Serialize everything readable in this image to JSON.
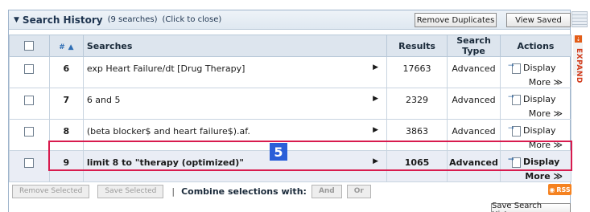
{
  "header": {
    "title": "Search History",
    "count": "(9 searches)",
    "hint": "(Click to close)",
    "remove_duplicates": "Remove Duplicates",
    "view_saved": "View Saved"
  },
  "table": {
    "columns": [
      "#",
      "Searches",
      "Results",
      "Search Type",
      "Actions"
    ],
    "sort_indicator": "▲",
    "rows": [
      {
        "num": "6",
        "search": "exp Heart Failure/dt [Drug Therapy]",
        "results": "17663",
        "type": "Advanced",
        "display": "Display",
        "more": "More ≫"
      },
      {
        "num": "7",
        "search": "6 and 5",
        "results": "2329",
        "type": "Advanced",
        "display": "Display",
        "more": "More ≫"
      },
      {
        "num": "8",
        "search": "(beta blocker$ and heart failure$).af.",
        "results": "3863",
        "type": "Advanced",
        "display": "Display",
        "more": "More ≫"
      },
      {
        "num": "9",
        "search": "limit 8 to \"therapy (optimized)\"",
        "results": "1065",
        "type": "Advanced",
        "display": "Display",
        "more": "More ≫"
      }
    ]
  },
  "marker": "5",
  "bottom": {
    "remove_selected": "Remove Selected",
    "save_selected": "Save Selected",
    "combine_label": "Combine selections with:",
    "and": "And",
    "or": "Or",
    "rss": "RSS",
    "save_history": "Save Search History"
  },
  "expand": "EXPAND",
  "colors": {
    "highlight": "#d81b4e",
    "accent": "#2b5fd8",
    "rss": "#f58220"
  }
}
